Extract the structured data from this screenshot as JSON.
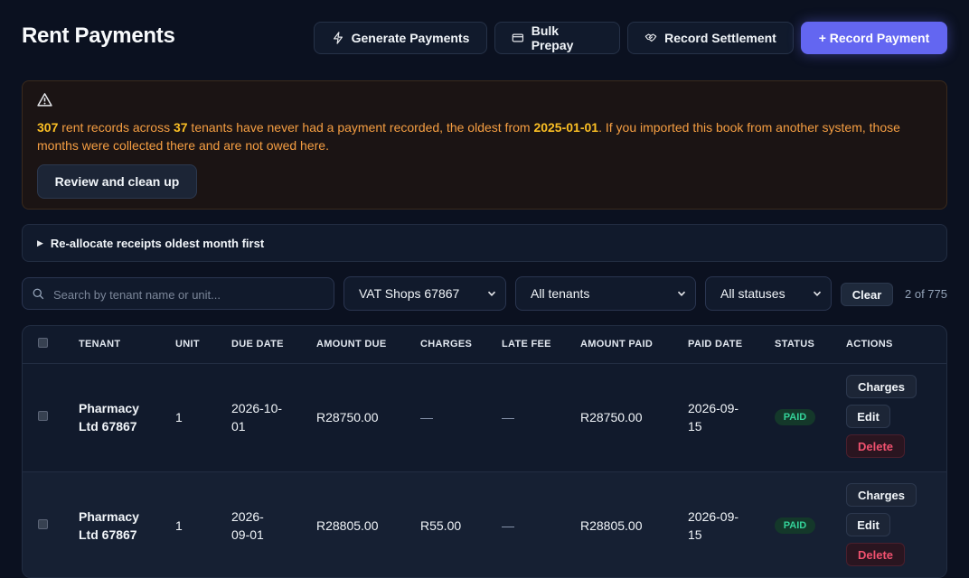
{
  "header": {
    "title": "Rent Payments",
    "generate_label": "Generate Payments",
    "bulk_label": "Bulk Prepay",
    "settlement_label": "Record Settlement",
    "record_label": "+ Record Payment"
  },
  "alert": {
    "records_count": "307",
    "text_1": " rent records across ",
    "tenants_count": "37",
    "text_2": " tenants have never had a payment recorded, the oldest from ",
    "oldest_date": "2025-01-01",
    "text_3": ". If you imported this book from another system, those months were collected there and are not owed here.",
    "button_label": "Review and clean up"
  },
  "reallocate": {
    "label": "Re-allocate receipts oldest month first"
  },
  "filters": {
    "search_placeholder": "Search by tenant name or unit...",
    "property": "VAT Shops 67867",
    "tenant": "All tenants",
    "status": "All statuses",
    "clear_label": "Clear",
    "count": "2 of 775"
  },
  "table": {
    "columns": [
      "TENANT",
      "UNIT",
      "DUE DATE",
      "AMOUNT DUE",
      "CHARGES",
      "LATE FEE",
      "AMOUNT PAID",
      "PAID DATE",
      "STATUS",
      "ACTIONS"
    ],
    "rows": [
      {
        "tenant_l1": "Pharmacy",
        "tenant_l2": "Ltd 67867",
        "unit": "1",
        "due_l1": "2026-10-",
        "due_l2": "01",
        "amount_due": "R28750.00",
        "charges": "—",
        "late_fee": "—",
        "amount_paid": "R28750.00",
        "paid_l1": "2026-09-",
        "paid_l2": "15",
        "status": "PAID",
        "actions": {
          "charges": "Charges",
          "edit": "Edit",
          "delete": "Delete"
        }
      },
      {
        "tenant_l1": "Pharmacy",
        "tenant_l2": "Ltd 67867",
        "unit": "1",
        "due_l1": "2026-",
        "due_l2": "09-01",
        "amount_due": "R28805.00",
        "charges": "R55.00",
        "late_fee": "—",
        "amount_paid": "R28805.00",
        "paid_l1": "2026-09-",
        "paid_l2": "15",
        "status": "PAID",
        "actions": {
          "charges": "Charges",
          "edit": "Edit",
          "delete": "Delete"
        }
      }
    ]
  },
  "colors": {
    "background": "#0b1120",
    "primary": "#6366f1",
    "warning_text": "#f59e42",
    "paid_badge": "#34d399",
    "delete": "#f0516e"
  },
  "icons": [
    "bolt-icon",
    "card-icon",
    "handshake-icon",
    "warning-icon",
    "search-icon",
    "chevron-down-icon",
    "triangle-right-icon"
  ]
}
